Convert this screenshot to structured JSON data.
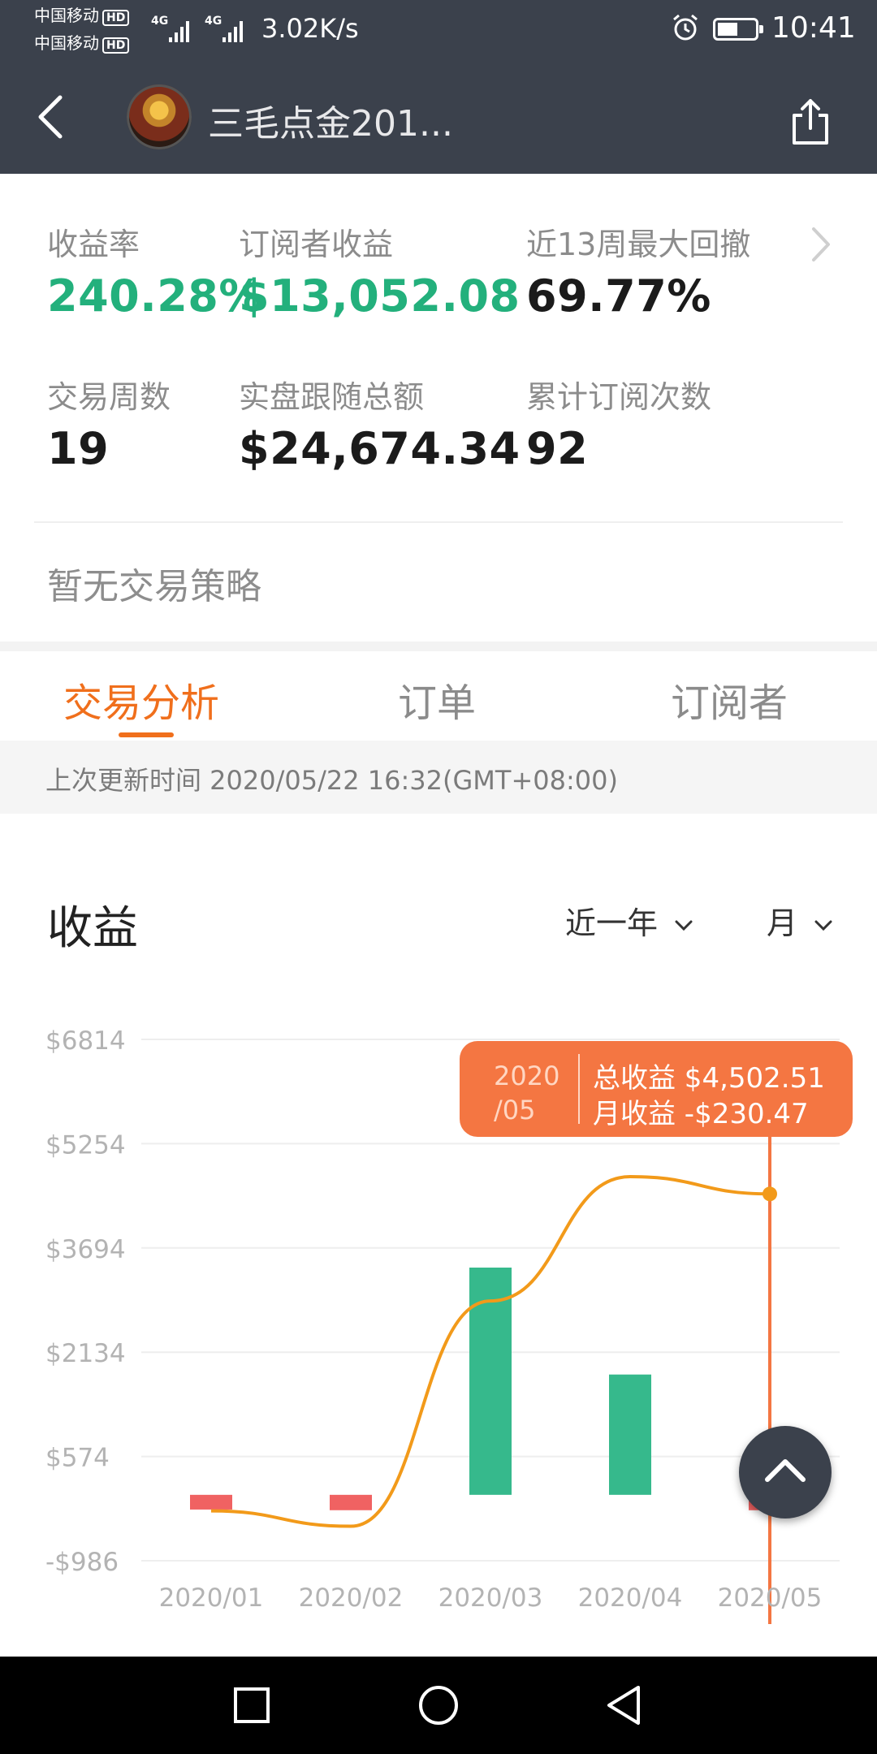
{
  "status_bar": {
    "carrier_1": "中国移动",
    "carrier_2": "中国移动",
    "hd_badge": "HD",
    "network": "4G",
    "net_speed": "3.02K/s",
    "time": "10:41",
    "icons": [
      "alarm-icon",
      "battery-icon",
      "signal-icon"
    ]
  },
  "header": {
    "title": "三毛点金201...",
    "back_icon": "chevron-left-icon",
    "share_icon": "share-icon"
  },
  "stats": {
    "return_rate": {
      "label": "收益率",
      "value": "240.28%"
    },
    "subscriber_profit": {
      "label": "订阅者收益",
      "value": "$13,052.08"
    },
    "max_drawdown": {
      "label": "近13周最大回撤",
      "value": "69.77%"
    },
    "trade_weeks": {
      "label": "交易周数",
      "value": "19"
    },
    "follow_total": {
      "label": "实盘跟随总额",
      "value": "$24,674.34"
    },
    "subscribe_count": {
      "label": "累计订阅次数",
      "value": "92"
    }
  },
  "strategy_text": "暂无交易策略",
  "tabs": [
    {
      "label": "交易分析",
      "active": true
    },
    {
      "label": "订单",
      "active": false
    },
    {
      "label": "订阅者",
      "active": false
    }
  ],
  "last_update": "上次更新时间 2020/05/22 16:32(GMT+08:00)",
  "profit_section": {
    "title": "收益",
    "range_dropdown": "近一年",
    "period_dropdown": "月"
  },
  "tooltip": {
    "date_line1": "2020",
    "date_line2": "/05",
    "total_label": "总收益 $4,502.51",
    "monthly_label": "月收益 -$230.47"
  },
  "colors": {
    "header_bg": "#3b414c",
    "green": "#23b07c",
    "orange_accent": "#f06f1c",
    "bar_positive": "#36b98c",
    "bar_negative": "#f06262",
    "line": "#f29a1a",
    "tooltip_bg": "#f47642"
  },
  "chart_data": {
    "type": "bar",
    "categories": [
      "2020/01",
      "2020/02",
      "2020/03",
      "2020/04",
      "2020/05"
    ],
    "ylim": [
      -986,
      6814
    ],
    "y_ticks": [
      "$6814",
      "$5254",
      "$3694",
      "$2134",
      "$574",
      "-$986"
    ],
    "y_tick_values": [
      6814,
      5254,
      3694,
      2134,
      574,
      -986
    ],
    "series": [
      {
        "values": [
          -220,
          -230,
          3400,
          1800,
          -230.47
        ]
      },
      {
        "values": [
          -240,
          -470,
          2900,
          4760,
          4502.51
        ]
      }
    ],
    "grid": true,
    "legend": "none"
  },
  "fab_icon": "chevron-up-icon",
  "nav_icons": [
    "recent-apps-icon",
    "home-icon",
    "back-triangle-icon"
  ]
}
